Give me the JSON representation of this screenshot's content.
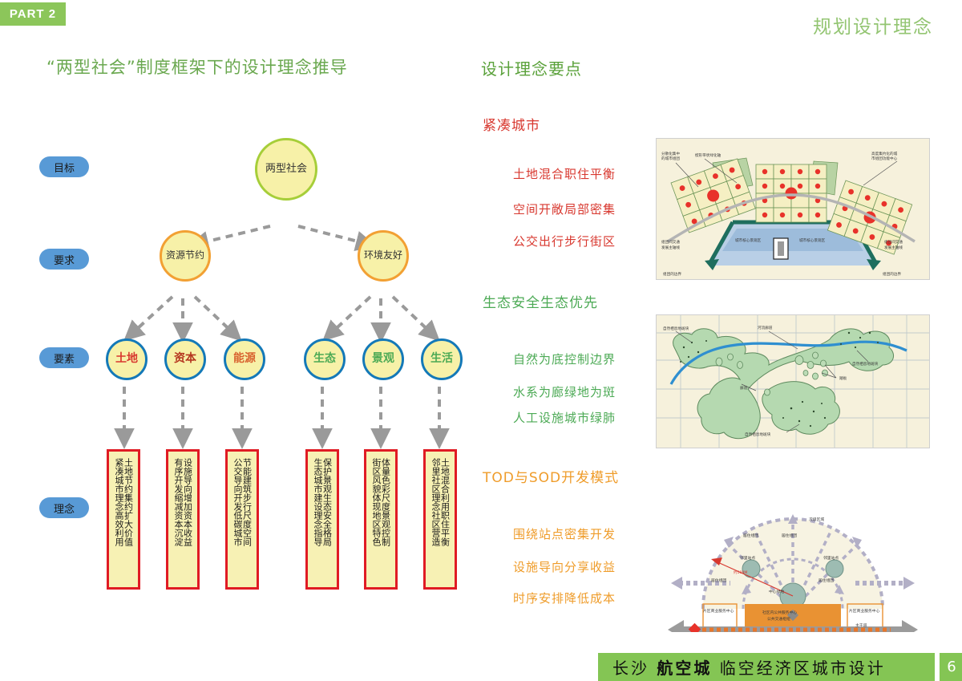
{
  "header": {
    "part_label": "Part 2",
    "title": "规划设计理念",
    "accent_green": "#8cc65a",
    "title_color": "#93c572"
  },
  "left_panel": {
    "title": "“两型社会”制度框架下的设计理念推导",
    "row_labels": [
      {
        "label": "目标"
      },
      {
        "label": "要求"
      },
      {
        "label": "要素"
      },
      {
        "label": "理念"
      }
    ],
    "root_node": {
      "label": "两型社会",
      "border": "#a6ce39",
      "fill": "#f7f1a8"
    },
    "mid_nodes": [
      {
        "label": "资源节约",
        "border": "#f2a033"
      },
      {
        "label": "环境友好",
        "border": "#f2a033"
      }
    ],
    "leaf_nodes": [
      {
        "label": "土地",
        "color": "#d8382f"
      },
      {
        "label": "资本",
        "color": "#b5361f"
      },
      {
        "label": "能源",
        "color": "#d8622f"
      },
      {
        "label": "生态",
        "color": "#4caa55"
      },
      {
        "label": "景观",
        "color": "#4caa55"
      },
      {
        "label": "生活",
        "color": "#4caa55"
      }
    ],
    "concept_boxes": [
      {
        "line1": "土地节约集约扩大价值",
        "line2": "紧凑城市理念高效利用"
      },
      {
        "line1": "设施导向增加资本收益",
        "line2": "有序开发缩减资本沉淀"
      },
      {
        "line1": "节能建筑步行尺度空间",
        "line2": "公交导向开发低碳城市"
      },
      {
        "line1": "保护景观生态安全格局",
        "line2": "生态城市建设理念指导"
      },
      {
        "line1": "体量色彩尺度景观控制",
        "line2": "街区风貌体现地区特色"
      },
      {
        "line1": "土地混合利用职住平衡",
        "line2": "邻里社区理念社区营造"
      }
    ],
    "box_border_color": "#e01b24",
    "connector_color": "#9a9a9a"
  },
  "right_panel": {
    "title": "设计理念要点",
    "sections": [
      {
        "heading": "紧凑城市",
        "color": "#d8382f",
        "points": [
          "土地混合职住平衡",
          "空间开敞局部密集",
          "公交出行步行街区"
        ],
        "figure_name": "compact-city-diagram"
      },
      {
        "heading": "生态安全生态优先",
        "color": "#4caa55",
        "points": [
          "自然为底控制边界",
          "水系为廊绿地为斑",
          "人工设施城市绿肺"
        ],
        "figure_name": "ecological-corridor-diagram"
      },
      {
        "heading": "TOD与SOD开发模式",
        "color": "#ef9c2a",
        "points": [
          "围绕站点密集开发",
          "设施导向分享收益",
          "时序安排降低成本"
        ],
        "figure_name": "tod-sod-diagram"
      }
    ]
  },
  "figures": {
    "compact_city": {
      "labels": [
        "分散化集中的城市组团",
        "楔形带状绿化轴",
        "高度集约化的城市组团功能中心",
        "组团间交通发展主轴线",
        "城市核心景观区",
        "城市核心景观区",
        "组团间交通发展主轴线",
        "组团的边界",
        "组团的边界"
      ]
    },
    "ecological": {
      "labels": [
        "自然栖息地斑块",
        "河流廊道",
        "自然栖息地斑块",
        "廊道",
        "踏板",
        "自然栖息地斑块"
      ]
    },
    "tod": {
      "labels": [
        "次级区域",
        "居住组团",
        "居住组团",
        "邻里站点",
        "邻里站点",
        "居住组团",
        "居住组团",
        "中心绿地",
        "社区内公共服务中心",
        "公共交通枢纽",
        "片区商业服务中心",
        "片区商业服务中心",
        "主干道",
        "次级区域",
        "约500M"
      ]
    }
  },
  "footer": {
    "brand_prefix": "长沙",
    "brand_main": "航空城",
    "brand_suffix": "临空经济区城市设计",
    "page_number": "6",
    "bar_color": "#84c554"
  }
}
